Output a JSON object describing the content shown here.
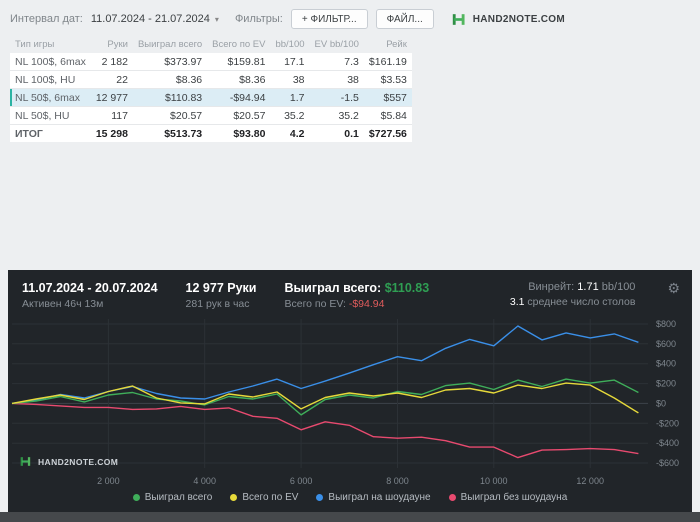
{
  "colors": {
    "positive": "#2f9e53",
    "negative": "#e04f4f",
    "brand-green": "#3fae5a",
    "panel-bg": "#212529"
  },
  "toolbar": {
    "date_label": "Интервал дат:",
    "date_value": "11.07.2024 - 21.07.2024",
    "filters_label": "Фильтры:",
    "add_filter_button": "+ ФИЛЬТР...",
    "file_button": "ФАЙЛ...",
    "brand": "HAND2NOTE.COM"
  },
  "table": {
    "headers": [
      "Тип игры",
      "Руки",
      "Выиграл всего",
      "Всего по EV",
      "bb/100",
      "EV bb/100",
      "Рейк"
    ],
    "rows": [
      {
        "cells": [
          "NL 100$, 6max",
          "2 182",
          "$373.97",
          "$159.81",
          "17.1",
          "7.3",
          "$161.19"
        ],
        "selected": false,
        "total": false
      },
      {
        "cells": [
          "NL 100$, HU",
          "22",
          "$8.36",
          "$8.36",
          "38",
          "38",
          "$3.53"
        ],
        "selected": false,
        "total": false
      },
      {
        "cells": [
          "NL 50$, 6max",
          "12 977",
          "$110.83",
          "-$94.94",
          "1.7",
          "-1.5",
          "$557"
        ],
        "selected": true,
        "total": false
      },
      {
        "cells": [
          "NL 50$, HU",
          "117",
          "$20.57",
          "$20.57",
          "35.2",
          "35.2",
          "$5.84"
        ],
        "selected": false,
        "total": false
      },
      {
        "cells": [
          "ИТОГ",
          "15 298",
          "$513.73",
          "$93.80",
          "4.2",
          "0.1",
          "$727.56"
        ],
        "selected": false,
        "total": true
      }
    ]
  },
  "panel": {
    "date_range": "11.07.2024 - 20.07.2024",
    "active_time": "Активен 46ч 13м",
    "hands": "12 977 Руки",
    "hands_per_hour": "281 рук в час",
    "won_label": "Выиграл всего:",
    "won_value": "$110.83",
    "ev_label": "Всего по EV:",
    "ev_value": "-$94.94",
    "winrate_label": "Винрейт:",
    "winrate_value": "1.71",
    "winrate_unit": "bb/100",
    "avg_tables_value": "3.1",
    "avg_tables_label": "среднее число столов",
    "brand": "HAND2NOTE.COM"
  },
  "chart_data": {
    "type": "line",
    "title": "",
    "xlabel": "",
    "ylabel": "",
    "grid": true,
    "legend_position": "bottom",
    "xlim": [
      0,
      13200
    ],
    "ylim": [
      -650,
      850
    ],
    "x": [
      0,
      500,
      1000,
      1500,
      2000,
      2500,
      3000,
      3500,
      4000,
      4500,
      5000,
      5500,
      6000,
      6500,
      7000,
      7500,
      8000,
      8500,
      9000,
      9500,
      10000,
      10500,
      11000,
      11500,
      12000,
      12500,
      13000
    ],
    "series": [
      {
        "name": "Выиграл всего",
        "color": "#3fae5a",
        "values": [
          0,
          25,
          70,
          15,
          85,
          110,
          45,
          25,
          -15,
          70,
          45,
          95,
          -115,
          40,
          85,
          55,
          120,
          90,
          180,
          205,
          140,
          235,
          170,
          245,
          205,
          235,
          110
        ]
      },
      {
        "name": "Всего по EV",
        "color": "#e6d93a",
        "values": [
          0,
          45,
          85,
          40,
          120,
          175,
          55,
          5,
          -5,
          95,
          65,
          115,
          -55,
          60,
          105,
          75,
          105,
          60,
          135,
          150,
          105,
          185,
          150,
          205,
          185,
          55,
          -95
        ]
      },
      {
        "name": "Выиграл на шоудауне",
        "color": "#3a8fe8",
        "values": [
          0,
          35,
          90,
          55,
          120,
          170,
          100,
          55,
          45,
          115,
          175,
          245,
          150,
          225,
          305,
          390,
          470,
          430,
          555,
          645,
          580,
          780,
          640,
          710,
          660,
          700,
          615
        ]
      },
      {
        "name": "Выиграл без шоудауна",
        "color": "#e84a6f",
        "values": [
          0,
          -10,
          -25,
          -40,
          -40,
          -60,
          -55,
          -30,
          -60,
          -45,
          -130,
          -150,
          -265,
          -185,
          -220,
          -335,
          -350,
          -340,
          -375,
          -440,
          -440,
          -545,
          -470,
          -465,
          -455,
          -465,
          -505
        ]
      }
    ],
    "xtick_values": [
      2000,
      4000,
      6000,
      8000,
      10000,
      12000
    ],
    "xtick_labels": [
      "2 000",
      "4 000",
      "6 000",
      "8 000",
      "10 000",
      "12 000"
    ],
    "ytick_values": [
      800,
      600,
      400,
      200,
      0,
      -200,
      -400,
      -600
    ],
    "ytick_labels": [
      "$800",
      "$600",
      "$400",
      "$200",
      "$0",
      "-$200",
      "-$400",
      "-$600"
    ]
  }
}
